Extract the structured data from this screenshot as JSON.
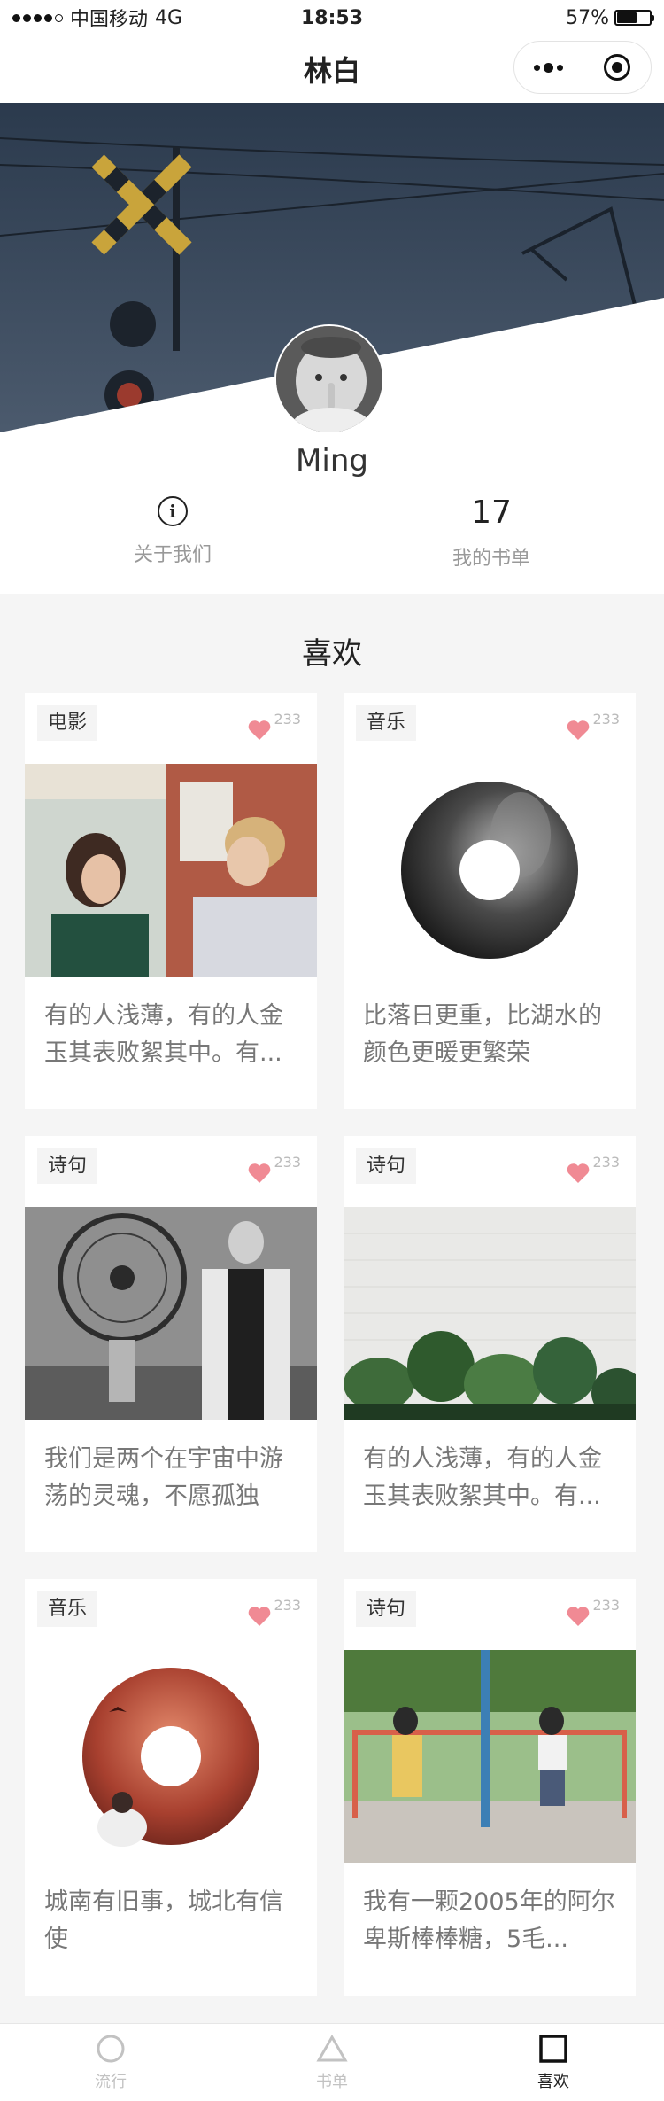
{
  "status_bar": {
    "carrier": "中国移动",
    "network": "4G",
    "time": "18:53",
    "battery": "57%",
    "battery_level": 0.57
  },
  "nav": {
    "title": "林白"
  },
  "profile": {
    "name": "Ming",
    "about_label": "关于我们",
    "book_count": "17",
    "book_label": "我的书单"
  },
  "section_title": "喜欢",
  "cards": [
    {
      "tag": "电影",
      "likes": "233",
      "text": "有的人浅薄，有的人金玉其表败絮其中。有...",
      "image": "movie-still-couple"
    },
    {
      "tag": "音乐",
      "likes": "233",
      "text": "比落日更重，比湖水的颜色更暖更繁荣",
      "image": "music-disc-portrait"
    },
    {
      "tag": "诗句",
      "likes": "233",
      "text": "我们是两个在宇宙中游荡的灵魂，不愿孤独",
      "image": "fan-and-woman-bw"
    },
    {
      "tag": "诗句",
      "likes": "233",
      "text": "有的人浅薄，有的人金玉其表败絮其中。有...",
      "image": "plants-white-wall"
    },
    {
      "tag": "音乐",
      "likes": "233",
      "text": "城南有旧事，城北有信使",
      "image": "music-disc-red-sky"
    },
    {
      "tag": "诗句",
      "likes": "233",
      "text": "我有一颗2005年的阿尔卑斯棒棒糖，5毛...",
      "image": "swings-couple"
    }
  ],
  "tabs": [
    {
      "label": "流行",
      "icon": "circle-icon",
      "active": false
    },
    {
      "label": "书单",
      "icon": "triangle-icon",
      "active": false
    },
    {
      "label": "喜欢",
      "icon": "square-icon",
      "active": true
    }
  ],
  "colors": {
    "accent_heart": "#f08a94",
    "highlight": "#fbeea5",
    "text_muted": "#999999"
  }
}
